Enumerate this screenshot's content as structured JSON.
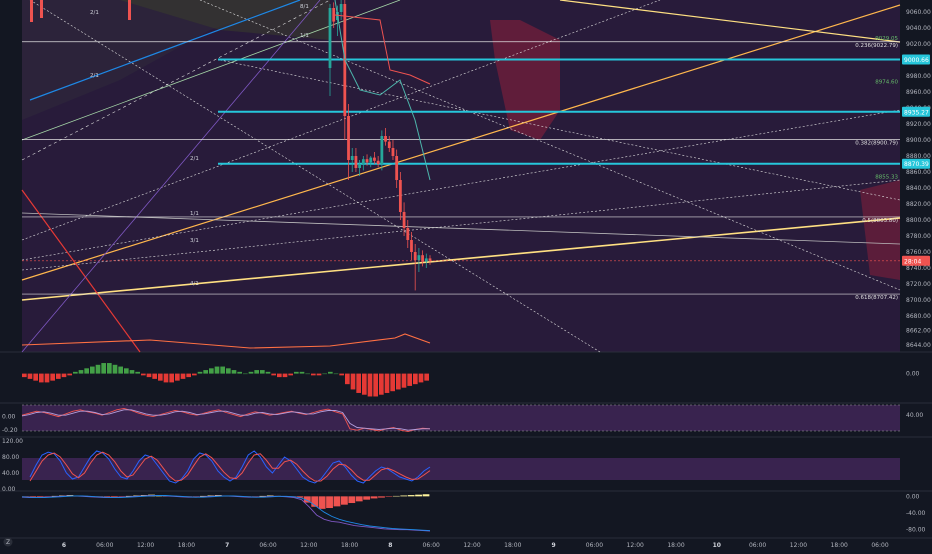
{
  "chart_data": [
    {
      "type": "candlestick",
      "panel": "main",
      "x_tick_labels": [
        "6",
        "06:00",
        "12:00",
        "18:00",
        "7",
        "06:00",
        "12:00",
        "18:00",
        "8",
        "06:00",
        "12:00",
        "18:00",
        "9",
        "06:00",
        "12:00",
        "18:00",
        "10",
        "06:00",
        "12:00",
        "18:00",
        "06:00"
      ],
      "y_tick_labels": [
        "9060.00",
        "9040.00",
        "9020.00",
        "8980.00",
        "8960.00",
        "8940.00",
        "8920.00",
        "8900.00",
        "8880.00",
        "8860.00",
        "8840.00",
        "8820.00",
        "8800.00",
        "8780.00",
        "8760.00",
        "8740.00",
        "8720.00",
        "8700.00",
        "8680.00",
        "8662.00",
        "8644.00"
      ],
      "ylim": [
        8635,
        9075
      ],
      "last_price": 8749,
      "price_badges": [
        {
          "label": "9000.66",
          "value": 9000.66,
          "color": "#26c6da"
        },
        {
          "label": "8935.27",
          "value": 8935.27,
          "color": "#26c6da"
        },
        {
          "label": "8870.39",
          "value": 8870.39,
          "color": "#26c6da"
        },
        {
          "label": "28:04",
          "value": 8749,
          "color": "#ef5350"
        }
      ],
      "fib_levels": [
        {
          "label": "0.236(9022.79)",
          "value": 9022.79
        },
        {
          "label": "0.382(8900.79)",
          "value": 8900.79
        },
        {
          "label": "0.5(8803.80)",
          "value": 8803.8
        },
        {
          "label": "0.618(8707.42)",
          "value": 8707.42
        }
      ],
      "horizontal_levels": [
        9000.66,
        8935.27,
        8870.39
      ],
      "green_level_labels": [
        {
          "label": "9029.05",
          "value": 9029.05
        },
        {
          "label": "8974.60",
          "value": 8974.6
        },
        {
          "label": "8855.33",
          "value": 8855.33
        }
      ],
      "gann_labels": [
        "2/1",
        "2/1",
        "1/1",
        "2/1",
        "1/1",
        "3/1",
        "4/1",
        "8/1"
      ],
      "candles": [
        {
          "o": 8990,
          "h": 9070,
          "l": 8955,
          "c": 9065
        },
        {
          "o": 9065,
          "h": 9072,
          "l": 9040,
          "c": 9048
        },
        {
          "o": 9050,
          "h": 9068,
          "l": 9030,
          "c": 9060
        },
        {
          "o": 9060,
          "h": 9075,
          "l": 9050,
          "c": 9070
        },
        {
          "o": 9070,
          "h": 9075,
          "l": 8900,
          "c": 8930
        },
        {
          "o": 8930,
          "h": 8945,
          "l": 8850,
          "c": 8875
        },
        {
          "o": 8875,
          "h": 8890,
          "l": 8860,
          "c": 8880
        },
        {
          "o": 8880,
          "h": 8890,
          "l": 8860,
          "c": 8865
        },
        {
          "o": 8865,
          "h": 8875,
          "l": 8855,
          "c": 8870
        },
        {
          "o": 8870,
          "h": 8880,
          "l": 8862,
          "c": 8876
        },
        {
          "o": 8876,
          "h": 8882,
          "l": 8868,
          "c": 8872
        },
        {
          "o": 8872,
          "h": 8880,
          "l": 8866,
          "c": 8878
        },
        {
          "o": 8878,
          "h": 8885,
          "l": 8870,
          "c": 8874
        },
        {
          "o": 8874,
          "h": 8880,
          "l": 8866,
          "c": 8870
        },
        {
          "o": 8870,
          "h": 8912,
          "l": 8862,
          "c": 8905
        },
        {
          "o": 8905,
          "h": 8915,
          "l": 8893,
          "c": 8898
        },
        {
          "o": 8898,
          "h": 8905,
          "l": 8885,
          "c": 8890
        },
        {
          "o": 8890,
          "h": 8900,
          "l": 8875,
          "c": 8880
        },
        {
          "o": 8880,
          "h": 8888,
          "l": 8840,
          "c": 8850
        },
        {
          "o": 8850,
          "h": 8860,
          "l": 8800,
          "c": 8810
        },
        {
          "o": 8810,
          "h": 8822,
          "l": 8780,
          "c": 8790
        },
        {
          "o": 8790,
          "h": 8800,
          "l": 8765,
          "c": 8775
        },
        {
          "o": 8775,
          "h": 8785,
          "l": 8750,
          "c": 8760
        },
        {
          "o": 8760,
          "h": 8770,
          "l": 8712,
          "c": 8750
        },
        {
          "o": 8750,
          "h": 8765,
          "l": 8735,
          "c": 8756
        },
        {
          "o": 8756,
          "h": 8762,
          "l": 8742,
          "c": 8748
        },
        {
          "o": 8748,
          "h": 8758,
          "l": 8740,
          "c": 8752
        },
        {
          "o": 8752,
          "h": 8756,
          "l": 8744,
          "c": 8749
        }
      ]
    },
    {
      "type": "bar",
      "panel": "histogram",
      "y_tick_labels": [
        "0.00"
      ],
      "ylim": [
        -15,
        10
      ],
      "values": [
        -2,
        -3,
        -4,
        -5,
        -5,
        -4,
        -3,
        -2,
        -1,
        1,
        2,
        3,
        4,
        5,
        6,
        6,
        5,
        4,
        3,
        2,
        1,
        -1,
        -2,
        -3,
        -4,
        -5,
        -5,
        -4,
        -3,
        -2,
        -1,
        1,
        2,
        3,
        4,
        4,
        3,
        2,
        1,
        0,
        1,
        2,
        2,
        1,
        -1,
        -2,
        -2,
        -1,
        1,
        1,
        0,
        -1,
        -1,
        0,
        1,
        0,
        -1,
        -6,
        -9,
        -11,
        -12,
        -13,
        -13,
        -12,
        -11,
        -10,
        -9,
        -8,
        -7,
        -6,
        -5,
        -4
      ]
    },
    {
      "type": "line",
      "panel": "oscillator-1",
      "y_tick_labels": [
        "0.00",
        "-0.20"
      ],
      "right_tick_labels": [
        "40.00"
      ],
      "ylim": [
        -0.3,
        0.2
      ],
      "series": [
        {
          "values": [
            0.02,
            0.05,
            0.08,
            0.06,
            0.03,
            0.0,
            0.04,
            0.08,
            0.1,
            0.07,
            0.05,
            0.02,
            0.06,
            0.1,
            0.12,
            0.09,
            0.05,
            0.02,
            0.0,
            0.03,
            0.06,
            0.09,
            0.07,
            0.04,
            0.02,
            0.05,
            0.08,
            0.1,
            0.06,
            0.03,
            0.0,
            0.04,
            0.07,
            0.05,
            0.02,
            0.04,
            0.06,
            0.08,
            0.05,
            0.03,
            0.06,
            0.09,
            0.11,
            0.07,
            0.04,
            -0.18,
            -0.2,
            -0.17,
            -0.19,
            -0.21,
            -0.18,
            -0.16,
            -0.2,
            -0.22,
            -0.19,
            -0.17,
            -0.18
          ],
          "color": "#ef5350"
        },
        {
          "values": [
            0.01,
            0.03,
            0.06,
            0.07,
            0.05,
            0.02,
            0.02,
            0.05,
            0.08,
            0.08,
            0.06,
            0.03,
            0.04,
            0.07,
            0.1,
            0.1,
            0.07,
            0.04,
            0.02,
            0.02,
            0.04,
            0.07,
            0.08,
            0.06,
            0.03,
            0.04,
            0.06,
            0.08,
            0.08,
            0.05,
            0.02,
            0.02,
            0.05,
            0.06,
            0.04,
            0.03,
            0.05,
            0.07,
            0.06,
            0.04,
            0.04,
            0.07,
            0.09,
            0.09,
            0.06,
            -0.1,
            -0.16,
            -0.17,
            -0.18,
            -0.19,
            -0.18,
            -0.17,
            -0.18,
            -0.2,
            -0.19,
            -0.18,
            -0.18
          ],
          "color": "#b39ddb"
        }
      ]
    },
    {
      "type": "line",
      "panel": "oscillator-2",
      "y_tick_labels": [
        "120.00",
        "80.00",
        "40.00",
        "0.00"
      ],
      "ylim": [
        0,
        120
      ],
      "series": [
        {
          "values": [
            30,
            60,
            85,
            92,
            88,
            70,
            40,
            25,
            30,
            55,
            80,
            95,
            90,
            75,
            50,
            30,
            25,
            45,
            70,
            85,
            80,
            60,
            40,
            20,
            15,
            25,
            45,
            75,
            90,
            85,
            70,
            45,
            30,
            20,
            30,
            55,
            85,
            95,
            80,
            55,
            40,
            60,
            80,
            70,
            50,
            30,
            20,
            15,
            25,
            45,
            65,
            70,
            55,
            35,
            20,
            15,
            30,
            45,
            55,
            50,
            40,
            30,
            25,
            20,
            30,
            45,
            55
          ],
          "color": "#2962ff"
        },
        {
          "values": [
            20,
            45,
            70,
            85,
            90,
            80,
            60,
            38,
            28,
            40,
            65,
            85,
            92,
            85,
            68,
            45,
            30,
            35,
            55,
            75,
            82,
            72,
            52,
            32,
            20,
            22,
            35,
            58,
            80,
            88,
            78,
            60,
            42,
            28,
            26,
            40,
            65,
            85,
            88,
            72,
            52,
            52,
            68,
            72,
            62,
            45,
            30,
            20,
            20,
            32,
            50,
            62,
            60,
            48,
            32,
            22,
            22,
            35,
            48,
            52,
            46,
            38,
            30,
            24,
            25,
            35,
            46
          ],
          "color": "#ef5350"
        }
      ]
    },
    {
      "type": "bar",
      "panel": "oscillator-3",
      "y_tick_labels": [
        "0.00",
        "-40.00",
        "-80.00"
      ],
      "ylim": [
        -95,
        8
      ],
      "values": [
        -2,
        -3,
        -2,
        -1,
        1,
        2,
        3,
        2,
        1,
        -1,
        -2,
        -3,
        -2,
        -1,
        1,
        2,
        3,
        4,
        3,
        2,
        1,
        -1,
        -2,
        -1,
        1,
        2,
        3,
        2,
        1,
        -1,
        -2,
        -1,
        1,
        2,
        1,
        -1,
        -2,
        -3,
        -15,
        -25,
        -30,
        -28,
        -24,
        -20,
        -16,
        -12,
        -8,
        -5,
        -3,
        -1,
        1,
        2,
        3,
        4,
        5
      ],
      "series": [
        {
          "values": [
            -2,
            -3,
            -3,
            -2,
            -1,
            0,
            1,
            1,
            0,
            -1,
            -2,
            -3,
            -3,
            -2,
            -1,
            0,
            1,
            2,
            2,
            1,
            0,
            -1,
            -2,
            -2,
            -1,
            0,
            1,
            1,
            0,
            -1,
            -2,
            -2,
            -1,
            0,
            0,
            -1,
            -3,
            -8,
            -25,
            -45,
            -55,
            -60,
            -62,
            -66,
            -70,
            -72,
            -74,
            -76,
            -78,
            -79,
            -80,
            -80,
            -81,
            -82,
            -83
          ],
          "color": "#7e57c2"
        },
        {
          "values": [
            -1,
            -2,
            -3,
            -3,
            -2,
            -1,
            0,
            1,
            1,
            0,
            -1,
            -2,
            -3,
            -3,
            -2,
            -1,
            0,
            1,
            2,
            2,
            1,
            0,
            -1,
            -2,
            -2,
            -1,
            0,
            1,
            1,
            0,
            -1,
            -2,
            -2,
            -1,
            0,
            0,
            -1,
            -4,
            -12,
            -25,
            -38,
            -48,
            -55,
            -60,
            -64,
            -68,
            -71,
            -73,
            -75,
            -77,
            -78,
            -79,
            -80,
            -81,
            -82
          ],
          "color": "#1e88e5"
        }
      ]
    }
  ],
  "colors": {
    "background": "#131722",
    "purple_zone": "#3b1f4e",
    "bull": "#26a69a",
    "bear": "#ef5350",
    "cyan": "#26c6da",
    "trendline": "#ffe082",
    "orange_trend": "#ffb74d",
    "fib": "#e0e0e0"
  },
  "corner_badge": "Z"
}
